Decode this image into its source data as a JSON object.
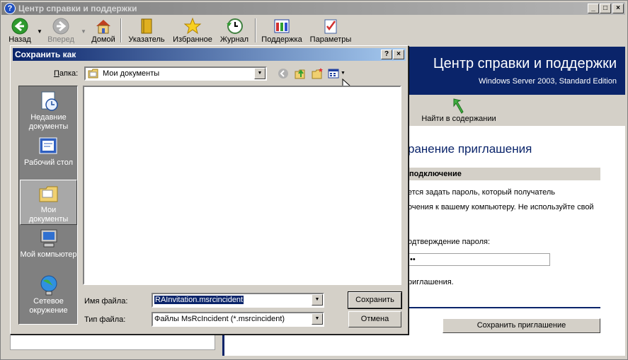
{
  "help_window": {
    "title": "Центр справки и поддержки",
    "title_icon": "help-icon",
    "caption_buttons": {
      "minimize": "_",
      "maximize": "□",
      "close": "×"
    },
    "toolbar": [
      {
        "id": "back",
        "label": "Назад",
        "icon": "back-arrow-icon"
      },
      {
        "id": "forward",
        "label": "Вперед",
        "icon": "forward-arrow-icon"
      },
      {
        "id": "home",
        "label": "Домой",
        "icon": "home-icon"
      },
      {
        "id": "index",
        "label": "Указатель",
        "icon": "book-icon"
      },
      {
        "id": "favorites",
        "label": "Избранное",
        "icon": "star-icon"
      },
      {
        "id": "history",
        "label": "Журнал",
        "icon": "history-icon"
      },
      {
        "id": "support",
        "label": "Поддержка",
        "icon": "support-icon"
      },
      {
        "id": "options",
        "label": "Параметры",
        "icon": "options-icon"
      }
    ],
    "header_title": "Центр справки и поддержки",
    "header_subtitle": "Windows Server 2003, Standard Edition",
    "find_in_contents": "Найти в содержании",
    "page_heading": "ранение приглашения",
    "section_heading": "подключение",
    "text_line1": "ется задать пароль, который получатель",
    "text_line2": "очения к вашему компьютеру. Не используйте свой",
    "confirm_label": "одтверждение пароля:",
    "password_dots": "••",
    "invitation_text": "риглашения.",
    "save_invitation_button": "Сохранить приглашение"
  },
  "save_dialog": {
    "title": "Сохранить как",
    "help_btn": "?",
    "close_btn": "×",
    "folder_label": "Папка:",
    "folder_value": "Мои документы",
    "places": [
      {
        "label": "Недавние документы",
        "icon": "recent-docs-icon"
      },
      {
        "label": "Рабочий стол",
        "icon": "desktop-icon"
      },
      {
        "label": "Мои документы",
        "icon": "my-documents-icon"
      },
      {
        "label": "Мой компьютер",
        "icon": "my-computer-icon"
      },
      {
        "label": "Сетевое окружение",
        "icon": "network-icon"
      }
    ],
    "filename_label": "Имя файла:",
    "filename_value": "RAInvitation.msrcincident",
    "filetype_label": "Тип файла:",
    "filetype_value": "Файлы MsRcIncident (*.msrcincident)",
    "save_label": "Сохранить",
    "cancel_label": "Отмена"
  },
  "colors": {
    "active_title": "#0a246a",
    "inactive_title": "#808080",
    "face": "#d4d0c8"
  }
}
